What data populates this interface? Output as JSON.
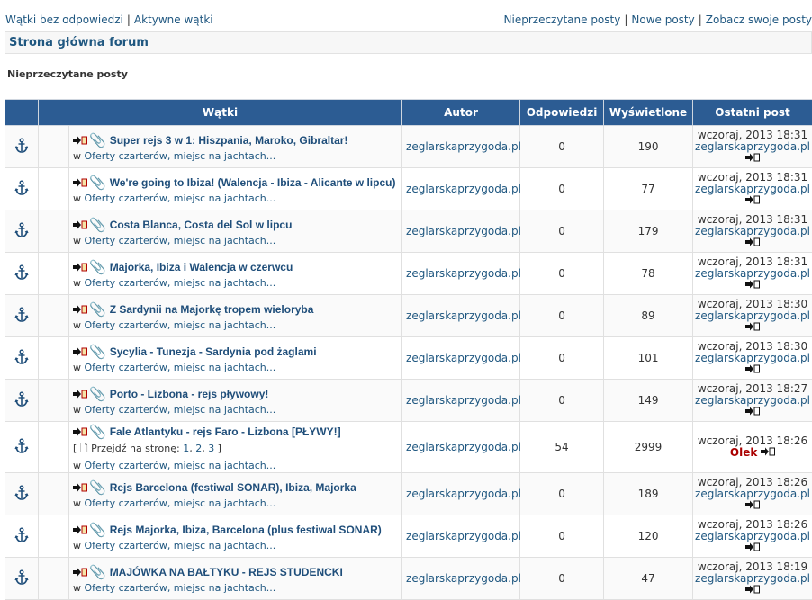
{
  "topnav": {
    "left": [
      "Wątki bez odpowiedzi",
      "Aktywne wątki"
    ],
    "right": [
      "Nieprzeczytane posty",
      "Nowe posty",
      "Zobacz swoje posty"
    ],
    "separator": "|"
  },
  "breadcrumb": "Strona główna forum",
  "section_title": "Nieprzeczytane posty",
  "table": {
    "headers": [
      "Wątki",
      "Autor",
      "Odpowiedzi",
      "Wyświetlone",
      "Ostatni post"
    ],
    "forum_prefix": "w",
    "forum_name": "Oferty czarterów, miejsc na jachtach...",
    "rows": [
      {
        "title": "Super rejs 3 w 1: Hiszpania, Maroko, Gibraltar!",
        "author": "zeglarskaprzygoda.pl",
        "replies": "0",
        "views": "190",
        "last_date": "wczoraj, 2013 18:31",
        "last_user": "zeglarskaprzygoda.pl"
      },
      {
        "title": "We're going to Ibiza! (Walencja - Ibiza - Alicante w lipcu)",
        "author": "zeglarskaprzygoda.pl",
        "replies": "0",
        "views": "77",
        "last_date": "wczoraj, 2013 18:31",
        "last_user": "zeglarskaprzygoda.pl"
      },
      {
        "title": "Costa Blanca, Costa del Sol w lipcu",
        "author": "zeglarskaprzygoda.pl",
        "replies": "0",
        "views": "179",
        "last_date": "wczoraj, 2013 18:31",
        "last_user": "zeglarskaprzygoda.pl"
      },
      {
        "title": "Majorka, Ibiza i Walencja w czerwcu",
        "author": "zeglarskaprzygoda.pl",
        "replies": "0",
        "views": "78",
        "last_date": "wczoraj, 2013 18:31",
        "last_user": "zeglarskaprzygoda.pl"
      },
      {
        "title": "Z Sardynii na Majorkę tropem wieloryba",
        "author": "zeglarskaprzygoda.pl",
        "replies": "0",
        "views": "89",
        "last_date": "wczoraj, 2013 18:30",
        "last_user": "zeglarskaprzygoda.pl"
      },
      {
        "title": "Sycylia - Tunezja - Sardynia pod żaglami",
        "author": "zeglarskaprzygoda.pl",
        "replies": "0",
        "views": "101",
        "last_date": "wczoraj, 2013 18:30",
        "last_user": "zeglarskaprzygoda.pl"
      },
      {
        "title": "Porto - Lizbona - rejs pływowy!",
        "author": "zeglarskaprzygoda.pl",
        "replies": "0",
        "views": "149",
        "last_date": "wczoraj, 2013 18:27",
        "last_user": "zeglarskaprzygoda.pl"
      },
      {
        "title": "Fale Atlantyku - rejs Faro - Lizbona [PŁYWY!]",
        "author": "zeglarskaprzygoda.pl",
        "replies": "54",
        "views": "2999",
        "last_date": "wczoraj, 2013 18:26",
        "last_user": "Olek",
        "pagination": {
          "label": "Przejdź na stronę:",
          "pages": [
            "1",
            "2",
            "3"
          ]
        }
      },
      {
        "title": "Rejs Barcelona (festiwal SONAR), Ibiza, Majorka",
        "author": "zeglarskaprzygoda.pl",
        "replies": "0",
        "views": "189",
        "last_date": "wczoraj, 2013 18:26",
        "last_user": "zeglarskaprzygoda.pl"
      },
      {
        "title": "Rejs Majorka, Ibiza, Barcelona (plus festiwal SONAR)",
        "author": "zeglarskaprzygoda.pl",
        "replies": "0",
        "views": "120",
        "last_date": "wczoraj, 2013 18:26",
        "last_user": "zeglarskaprzygoda.pl"
      },
      {
        "title": "MAJÓWKA NA BAŁTYKU - REJS STUDENCKI",
        "author": "zeglarskaprzygoda.pl",
        "replies": "0",
        "views": "47",
        "last_date": "wczoraj, 2013 18:19",
        "last_user": "zeglarskaprzygoda.pl"
      }
    ]
  },
  "icons": {
    "row": "anchor-icon",
    "newpost": "new-post-icon",
    "attachment": "paperclip-icon",
    "last": "view-latest-post-icon"
  },
  "colors": {
    "header_bg": "#2c5c93",
    "link": "#1f5780",
    "highlight_user": "#aa0000"
  }
}
